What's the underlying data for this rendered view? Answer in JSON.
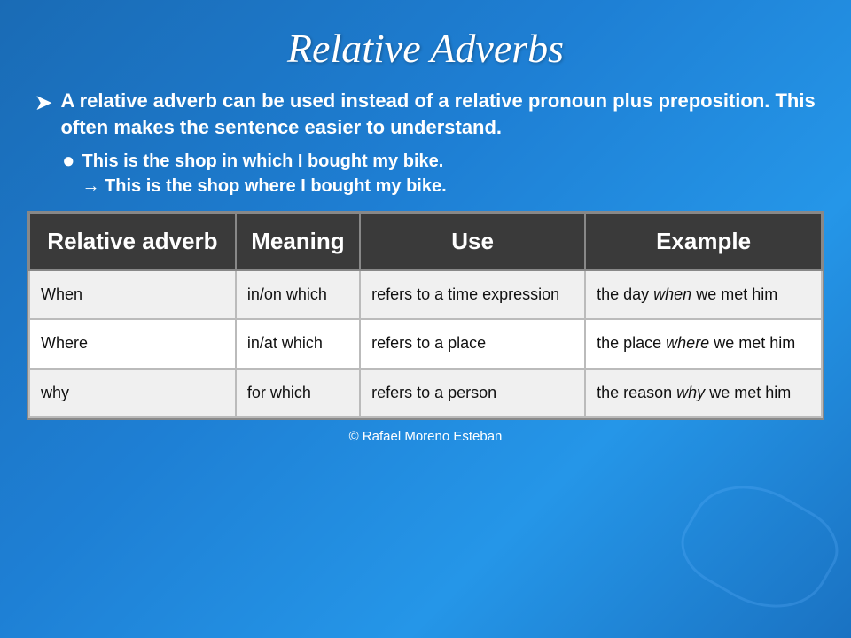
{
  "title": "Relative Adverbs",
  "intro": {
    "main_text": "A relative adverb can be used instead of a relative pronoun plus preposition. This often makes the sentence easier to understand.",
    "sub_text_line1": "This is the shop in which I bought my bike.",
    "sub_text_line2": "→ This is the shop where I bought my bike."
  },
  "table": {
    "headers": [
      "Relative adverb",
      "Meaning",
      "Use",
      "Example"
    ],
    "rows": [
      {
        "adverb": "When",
        "meaning": "in/on which",
        "use": "refers to a time expression",
        "example_plain": "the day ",
        "example_italic": "when",
        "example_end": " we met him"
      },
      {
        "adverb": "Where",
        "meaning": "in/at which",
        "use": "refers to a place",
        "example_plain": "the place ",
        "example_italic": "where",
        "example_end": " we met him"
      },
      {
        "adverb": "why",
        "meaning": "for which",
        "use": "refers to a person",
        "example_plain": "the reason ",
        "example_italic": "why",
        "example_end": " we met him"
      }
    ]
  },
  "footer": "© Rafael Moreno Esteban"
}
